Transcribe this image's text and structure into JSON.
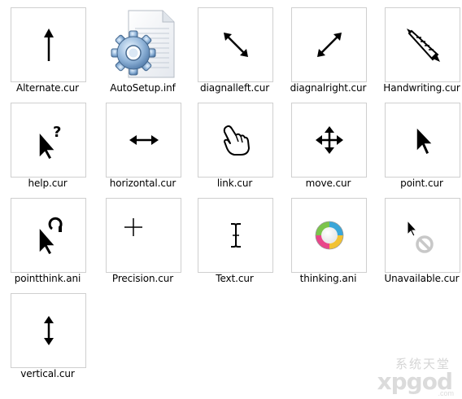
{
  "files": [
    {
      "name": "Alternate.cur",
      "icon": "alternate-cursor-icon"
    },
    {
      "name": "AutoSetup.inf",
      "icon": "setup-information-file-icon"
    },
    {
      "name": "diagnalleft.cur",
      "icon": "diagonal-left-cursor-icon"
    },
    {
      "name": "diagnalright.cur",
      "icon": "diagonal-right-cursor-icon"
    },
    {
      "name": "Handwriting.cur",
      "icon": "handwriting-cursor-icon"
    },
    {
      "name": "help.cur",
      "icon": "help-cursor-icon"
    },
    {
      "name": "horizontal.cur",
      "icon": "horizontal-resize-cursor-icon"
    },
    {
      "name": "link.cur",
      "icon": "link-hand-cursor-icon"
    },
    {
      "name": "move.cur",
      "icon": "move-cursor-icon"
    },
    {
      "name": "point.cur",
      "icon": "arrow-pointer-icon"
    },
    {
      "name": "pointthink.ani",
      "icon": "pointer-busy-cursor-icon"
    },
    {
      "name": "Precision.cur",
      "icon": "crosshair-cursor-icon"
    },
    {
      "name": "Text.cur",
      "icon": "text-ibeam-cursor-icon"
    },
    {
      "name": "thinking.ani",
      "icon": "busy-spinner-icon"
    },
    {
      "name": "Unavailable.cur",
      "icon": "unavailable-cursor-icon"
    },
    {
      "name": "vertical.cur",
      "icon": "vertical-resize-cursor-icon"
    }
  ],
  "watermark": {
    "cn": "系统天堂",
    "en": "xpgod",
    "domain": ".com"
  }
}
